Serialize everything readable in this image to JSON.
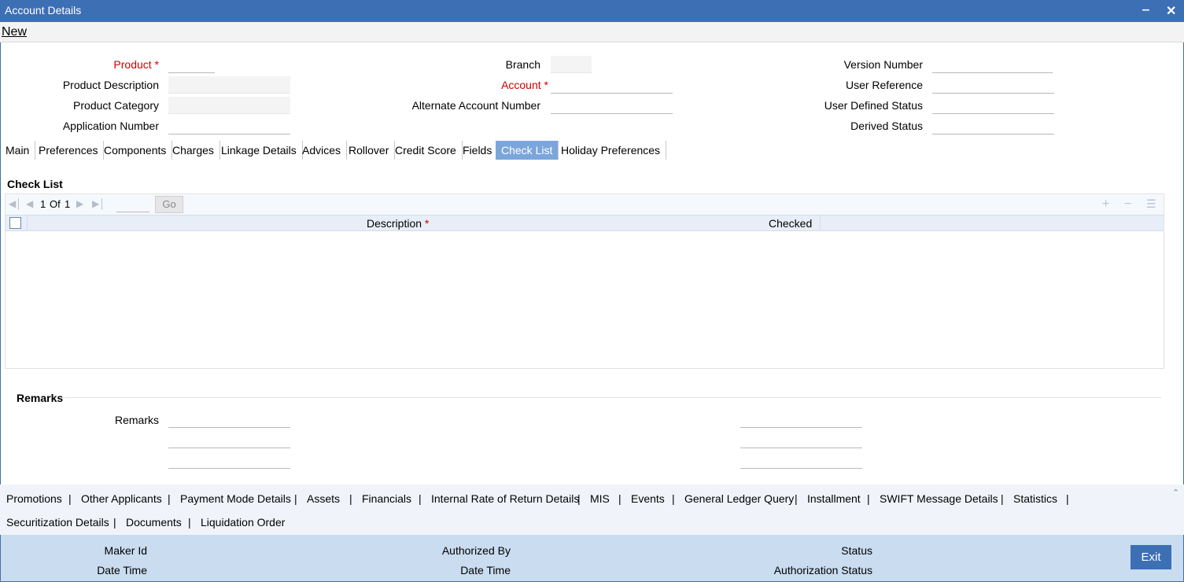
{
  "window": {
    "title": "Account Details",
    "minimize_glyph": "‒",
    "close_glyph": "✕"
  },
  "menu": {
    "new_label": "New"
  },
  "header_fields": {
    "product": {
      "label": "Product",
      "required_mark": "*",
      "value": ""
    },
    "product_description": {
      "label": "Product Description",
      "value": ""
    },
    "product_category": {
      "label": "Product Category",
      "value": ""
    },
    "application_number": {
      "label": "Application Number",
      "value": ""
    },
    "branch": {
      "label": "Branch",
      "value": ""
    },
    "account": {
      "label": "Account",
      "required_mark": "*",
      "value": ""
    },
    "alternate_account_number": {
      "label": "Alternate Account Number",
      "value": ""
    },
    "version_number": {
      "label": "Version Number",
      "value": ""
    },
    "user_reference": {
      "label": "User Reference",
      "value": ""
    },
    "user_defined_status": {
      "label": "User Defined Status",
      "value": ""
    },
    "derived_status": {
      "label": "Derived Status",
      "value": ""
    }
  },
  "tabs": [
    {
      "label": "Main"
    },
    {
      "label": "Preferences"
    },
    {
      "label": "Components"
    },
    {
      "label": "Charges"
    },
    {
      "label": "Linkage Details"
    },
    {
      "label": "Advices"
    },
    {
      "label": "Rollover"
    },
    {
      "label": "Credit Score"
    },
    {
      "label": "Fields"
    },
    {
      "label": "Check List",
      "active": true
    },
    {
      "label": "Holiday Preferences"
    }
  ],
  "check_list": {
    "title": "Check List",
    "pagination": {
      "current": "1",
      "of_label": "Of",
      "total": "1",
      "go_label": "Go",
      "page_input": ""
    },
    "columns": {
      "description": "Description",
      "description_required": "*",
      "checked": "Checked"
    },
    "toolbar_icons": [
      "add-row-icon",
      "delete-row-icon",
      "view-rows-icon"
    ]
  },
  "remarks": {
    "section_title": "Remarks",
    "label": "Remarks",
    "values": [
      "",
      "",
      "",
      "",
      "",
      ""
    ]
  },
  "links_row1": [
    "Promotions",
    "Other Applicants",
    "Payment Mode Details",
    "Assets",
    "Financials",
    "Internal Rate of Return Details",
    "MIS",
    "Events",
    "General Ledger Query",
    "Installment",
    "SWIFT Message Details",
    "Statistics"
  ],
  "links_row2": [
    "Securitization Details",
    "Documents",
    "Liquidation Order"
  ],
  "link_separator": "|",
  "footer": {
    "maker_id": "Maker Id",
    "date_time": "Date Time",
    "authorized_by": "Authorized By",
    "status": "Status",
    "authorization_status": "Authorization Status",
    "exit_label": "Exit"
  }
}
